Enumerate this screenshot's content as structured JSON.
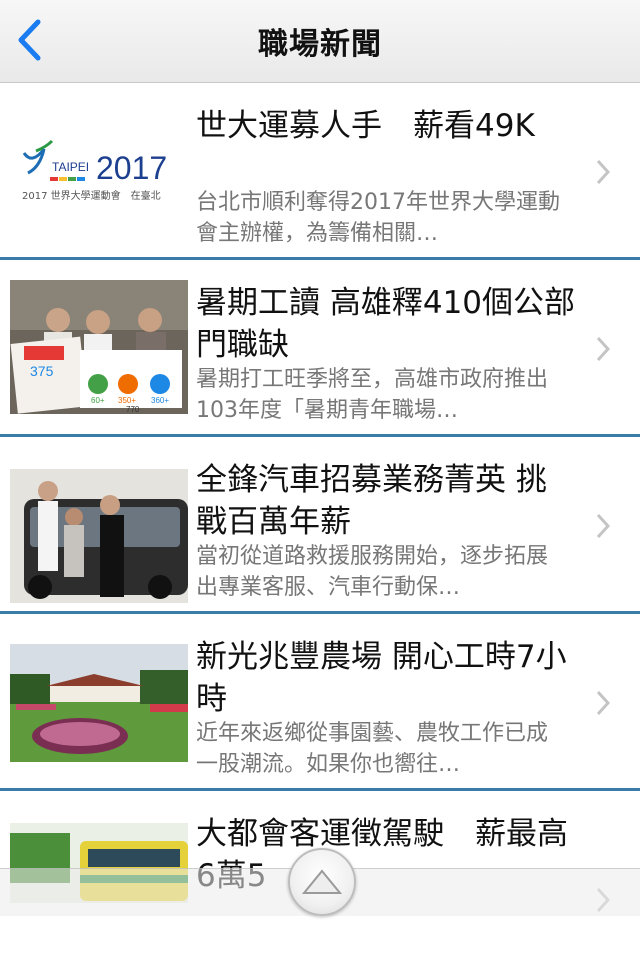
{
  "header": {
    "title": "職場新聞",
    "back_icon": "chevron-left-icon",
    "accent": "#1a7cf0"
  },
  "news": [
    {
      "title": "世大運募人手　薪看49K",
      "summary": "台北市順利奪得2017年世界大學運動會主辦權，為籌備相關…",
      "logo_main": "2017",
      "logo_city": "TAIPEI",
      "logo_caption": "2017 世界大學運動會　在臺北"
    },
    {
      "title": "暑期工讀 高雄釋410個公部門職缺",
      "summary": "暑期打工旺季將至，高雄市政府推出103年度「暑期青年職場…",
      "sign_main": "375",
      "sign_numbers": [
        "60+",
        "350+",
        "360+"
      ],
      "sign_total": "770"
    },
    {
      "title": "全鋒汽車招募業務菁英 挑戰百萬年薪",
      "summary": "當初從道路救援服務開始，逐步拓展出專業客服、汽車行動保…"
    },
    {
      "title": "新光兆豐農場 開心工時7小時",
      "summary": "近年來返鄉從事園藝、農牧工作已成一股潮流。如果你也嚮往…"
    },
    {
      "title": "大都會客運徵駕駛　薪最高6萬5",
      "summary": ""
    }
  ],
  "colors": {
    "separator": "#3a7ca8",
    "summary_text": "#777777",
    "chevron": "#c4c4c4"
  },
  "icons": {
    "chevron": "chevron-right-icon",
    "scroll_top": "scroll-to-top-icon"
  }
}
